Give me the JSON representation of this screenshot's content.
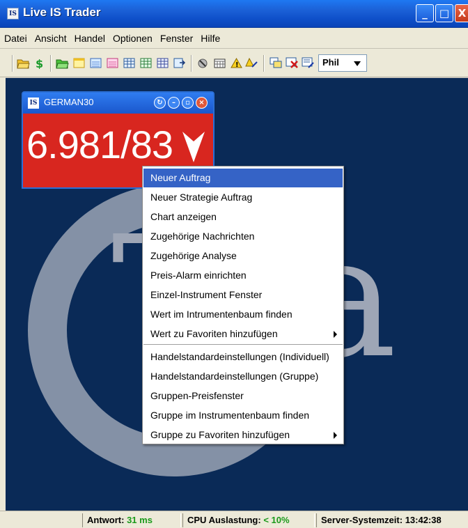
{
  "window": {
    "title": "Live IS Trader",
    "app_icon_text": "IS",
    "controls": {
      "minimize": "_",
      "maximize": "□",
      "close": "X"
    }
  },
  "menubar": {
    "items": [
      {
        "label": "Datei"
      },
      {
        "label": "Ansicht"
      },
      {
        "label": "Handel"
      },
      {
        "label": "Optionen"
      },
      {
        "label": "Fenster"
      },
      {
        "label": "Hilfe"
      }
    ]
  },
  "toolbar": {
    "profile_select": {
      "value": "Phil"
    },
    "icons": [
      "open-folder-icon",
      "dollar-icon",
      "green-folder-icon",
      "yellow-doc-icon",
      "blue-doc-icon",
      "pink-doc-icon",
      "grid-icon",
      "grid2-icon",
      "grid3-icon",
      "export-icon",
      "wrench-icon",
      "calendar-icon",
      "alert-icon",
      "alarm-edit-icon",
      "multi-window-icon",
      "close-window-icon",
      "window-edit-icon"
    ]
  },
  "price_widget": {
    "logo": "IS",
    "title": "GERMAN30",
    "price": "6.981/83",
    "direction": "down",
    "colors": {
      "body": "#d8261f",
      "title": "#1c5bd0"
    }
  },
  "background_logo_text": "Tra",
  "context_menu": {
    "items": [
      {
        "label": "Neuer Auftrag",
        "active": true
      },
      {
        "label": "Neuer Strategie Auftrag"
      },
      {
        "label": "Chart anzeigen"
      },
      {
        "label": "Zugehörige Nachrichten"
      },
      {
        "label": "Zugehörige Analyse"
      },
      {
        "label": "Preis-Alarm einrichten"
      },
      {
        "label": "Einzel-Instrument Fenster"
      },
      {
        "label": "Wert im Intrumentenbaum finden"
      },
      {
        "label": "Wert zu Favoriten hinzufügen",
        "submenu": true
      },
      {
        "label": "Handelstandardeinstellungen (Individuell)"
      },
      {
        "label": "Handelstandardeinstellungen (Gruppe)"
      },
      {
        "label": "Gruppen-Preisfenster"
      },
      {
        "label": "Gruppe im Instrumentenbaum finden"
      },
      {
        "label": "Gruppe zu Favoriten hinzufügen",
        "submenu": true
      }
    ]
  },
  "statusbar": {
    "response_label": "Antwort:",
    "response_value": "31 ms",
    "cpu_label": "CPU Auslastung:",
    "cpu_value": "< 10%",
    "server_label": "Server-Systemzeit:",
    "server_time": "13:42:38"
  }
}
